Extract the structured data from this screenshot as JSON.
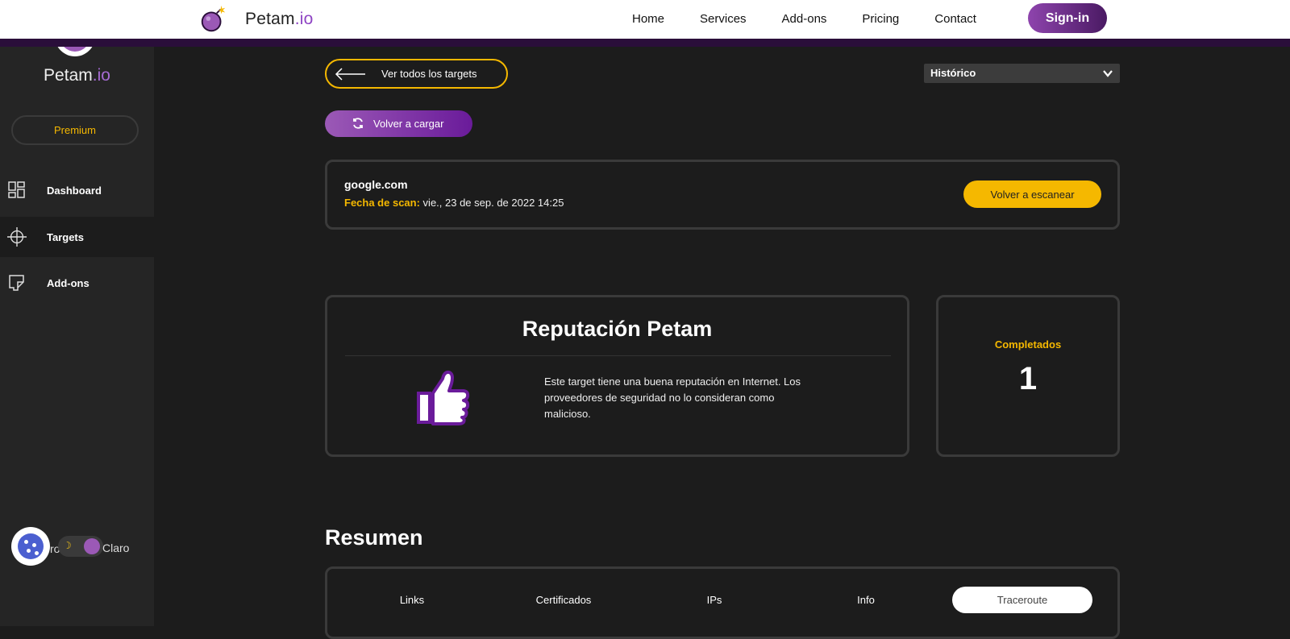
{
  "header": {
    "brand_main": "Petam",
    "brand_suffix": ".io",
    "nav": [
      "Home",
      "Services",
      "Add-ons",
      "Pricing",
      "Contact"
    ],
    "signin_label": "Sign-in"
  },
  "sidebar": {
    "brand_main": "Petam",
    "brand_suffix": ".io",
    "premium_label": "Premium",
    "items": [
      {
        "label": "Dashboard",
        "icon": "dashboard-icon"
      },
      {
        "label": "Targets",
        "icon": "crosshair-icon",
        "active": true
      },
      {
        "label": "Add-ons",
        "icon": "addons-icon"
      }
    ],
    "theme_dark_partial": "ro",
    "theme_light_label": "Claro"
  },
  "toolbar": {
    "back_label": "Ver todos los targets",
    "history_select": "Histórico",
    "reload_label": "Volver a cargar"
  },
  "scan": {
    "domain": "google.com",
    "date_key": "Fecha de scan:",
    "date_value": " vie., 23 de sep. de 2022 14:25",
    "rescan_label": "Volver a escanear"
  },
  "reputation": {
    "title": "Reputación Petam",
    "text": "Este target tiene una buena reputación en Internet. Los proveedores de seguridad no lo consideran como malicioso."
  },
  "completed": {
    "label": "Completados",
    "value": "1"
  },
  "summary": {
    "title": "Resumen",
    "tabs": [
      "Links",
      "Certificados",
      "IPs",
      "Info",
      "Traceroute"
    ],
    "active_tab": "Traceroute"
  },
  "colors": {
    "accent_purple": "#9b59b6",
    "accent_yellow": "#f5b800",
    "background": "#1c1c1c"
  }
}
